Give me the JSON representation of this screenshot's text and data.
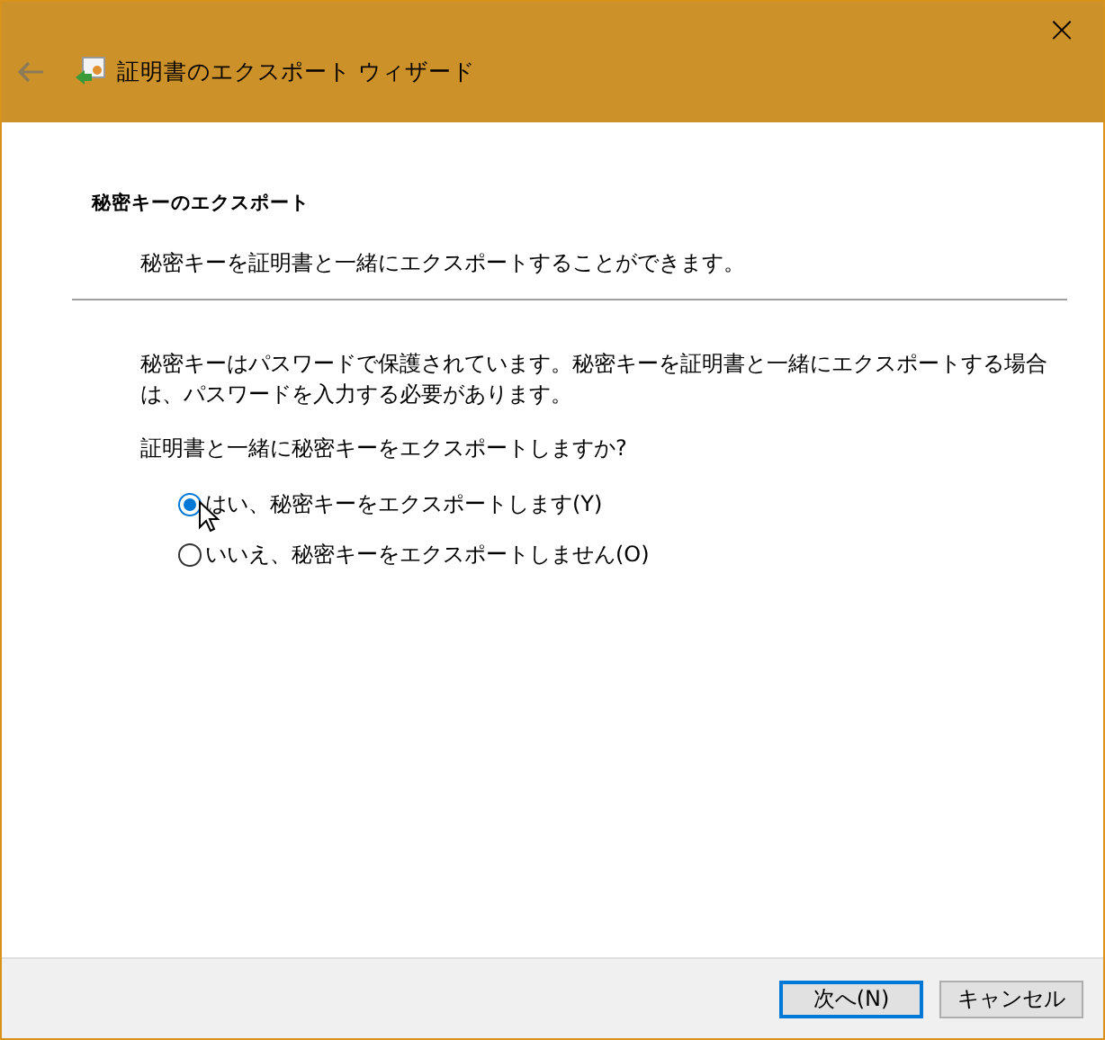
{
  "window": {
    "title": "証明書のエクスポート ウィザード",
    "close": "×"
  },
  "header": {
    "title": "秘密キーのエクスポート",
    "subtitle": "秘密キーを証明書と一緒にエクスポートすることができます。"
  },
  "description": "秘密キーはパスワードで保護されています。秘密キーを証明書と一緒にエクスポートする場合は、パスワードを入力する必要があります。",
  "question": "証明書と一緒に秘密キーをエクスポートしますか?",
  "options": [
    {
      "label": "はい、秘密キーをエクスポートします(Y)",
      "selected": true
    },
    {
      "label": "いいえ、秘密キーをエクスポートしません(O)",
      "selected": false
    }
  ],
  "buttons": [
    {
      "label": "次へ(N)",
      "default": true
    },
    {
      "label": "キャンセル",
      "default": false
    }
  ]
}
